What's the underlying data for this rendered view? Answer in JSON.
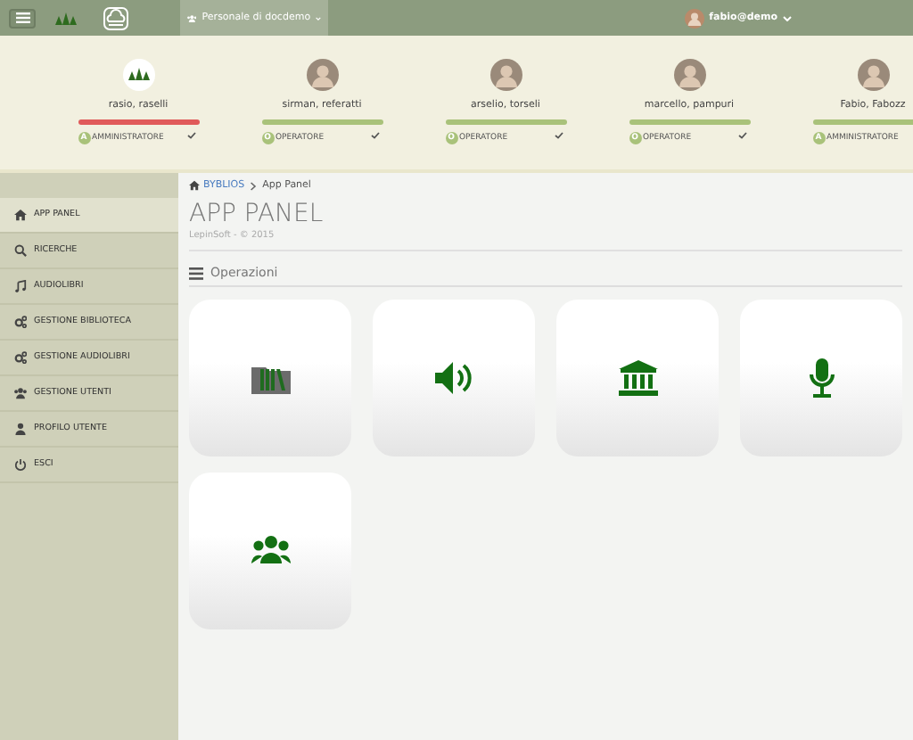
{
  "topbar": {
    "org_menu": "Personale di docdemo",
    "user_menu": "fabio@demo"
  },
  "users": [
    {
      "name": "rasio, raselli",
      "kind": "logo",
      "color": "#e05a5a",
      "role_letter": "A",
      "role": "AMMINISTRATORE"
    },
    {
      "name": "sirman, referatti",
      "kind": "photo",
      "color": "#a9c27a",
      "role_letter": "O",
      "role": "OPERATORE"
    },
    {
      "name": "arselio, torseli",
      "kind": "photo",
      "color": "#a9c27a",
      "role_letter": "O",
      "role": "OPERATORE"
    },
    {
      "name": "marcello, pampuri",
      "kind": "photo",
      "color": "#a9c27a",
      "role_letter": "O",
      "role": "OPERATORE"
    },
    {
      "name": "Fabio, Fabozz",
      "kind": "photo",
      "color": "#a9c27a",
      "role_letter": "A",
      "role": "AMMINISTRATORE"
    }
  ],
  "sidebar": {
    "items": [
      {
        "label": "APP PANEL",
        "kind": "home",
        "selected": true
      },
      {
        "label": "RICERCHE",
        "kind": "search",
        "selected": false
      },
      {
        "label": "AUDIOLIBRI",
        "kind": "music",
        "selected": false
      },
      {
        "label": "GESTIONE BIBLIOTECA",
        "kind": "cogs",
        "selected": false
      },
      {
        "label": "GESTIONE AUDIOLIBRI",
        "kind": "cogs",
        "selected": false
      },
      {
        "label": "GESTIONE UTENTI",
        "kind": "users",
        "selected": false
      },
      {
        "label": "PROFILO UTENTE",
        "kind": "user",
        "selected": false
      },
      {
        "label": "ESCI",
        "kind": "power",
        "selected": false
      }
    ]
  },
  "breadcrumb": [
    "BYBLIOS",
    "App Panel"
  ],
  "page": {
    "title": "APP PANEL",
    "subtitle": "LepinSoft - © 2015"
  },
  "section": {
    "title": "Operazioni"
  },
  "tiles": [
    {
      "kind": "folder"
    },
    {
      "kind": "speaker"
    },
    {
      "kind": "bank"
    },
    {
      "kind": "microphone"
    },
    {
      "kind": "group"
    }
  ]
}
